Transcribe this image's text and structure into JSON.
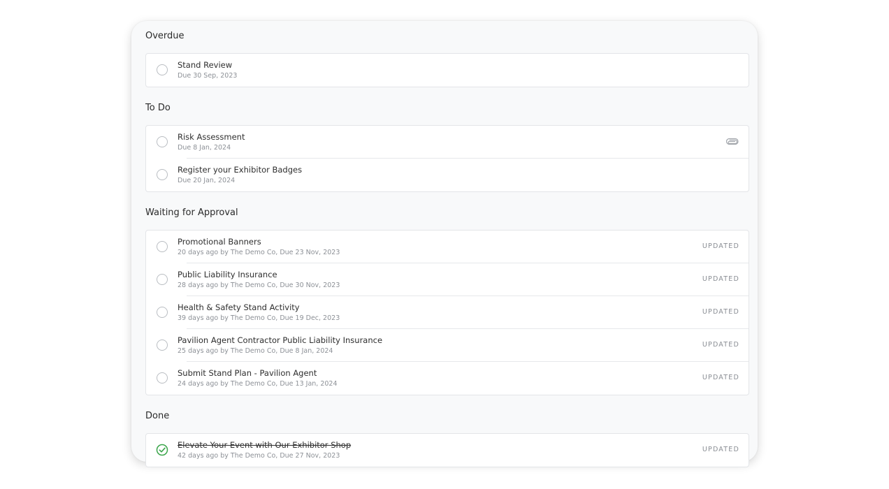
{
  "sections": [
    {
      "title": "Overdue",
      "tasks": [
        {
          "title": "Stand Review",
          "subtitle": "Due 30 Sep, 2023"
        }
      ]
    },
    {
      "title": "To Do",
      "tasks": [
        {
          "title": "Risk Assessment",
          "subtitle": "Due 8 Jan, 2024",
          "icon": "paperclip-icon"
        },
        {
          "title": "Register your Exhibitor Badges",
          "subtitle": "Due 20 Jan, 2024"
        }
      ]
    },
    {
      "title": "Waiting for Approval",
      "tasks": [
        {
          "title": "Promotional Banners",
          "subtitle": "20 days ago by The Demo Co, Due 23 Nov, 2023",
          "status": "UPDATED"
        },
        {
          "title": "Public Liability Insurance",
          "subtitle": "28 days ago by The Demo Co, Due 30 Nov, 2023",
          "status": "UPDATED"
        },
        {
          "title": "Health & Safety Stand Activity",
          "subtitle": "39 days ago by The Demo Co, Due 19 Dec, 2023",
          "status": "UPDATED"
        },
        {
          "title": "Pavilion Agent Contractor Public Liability Insurance",
          "subtitle": "25 days ago by The Demo Co, Due 8 Jan, 2024",
          "status": "UPDATED"
        },
        {
          "title": "Submit Stand Plan - Pavilion Agent",
          "subtitle": "24 days ago by The Demo Co, Due 13 Jan, 2024",
          "status": "UPDATED"
        }
      ]
    },
    {
      "title": "Done",
      "tasks": [
        {
          "title": "Elevate Your Event with Our Exhibitor Shop",
          "subtitle": "42 days ago by The Demo Co, Due 27 Nov, 2023",
          "status": "UPDATED",
          "completed": true
        }
      ]
    }
  ],
  "colors": {
    "check_green": "#3aa54a",
    "circle_border": "#b9bdc2",
    "panel_bg": "#f8f9fa"
  }
}
